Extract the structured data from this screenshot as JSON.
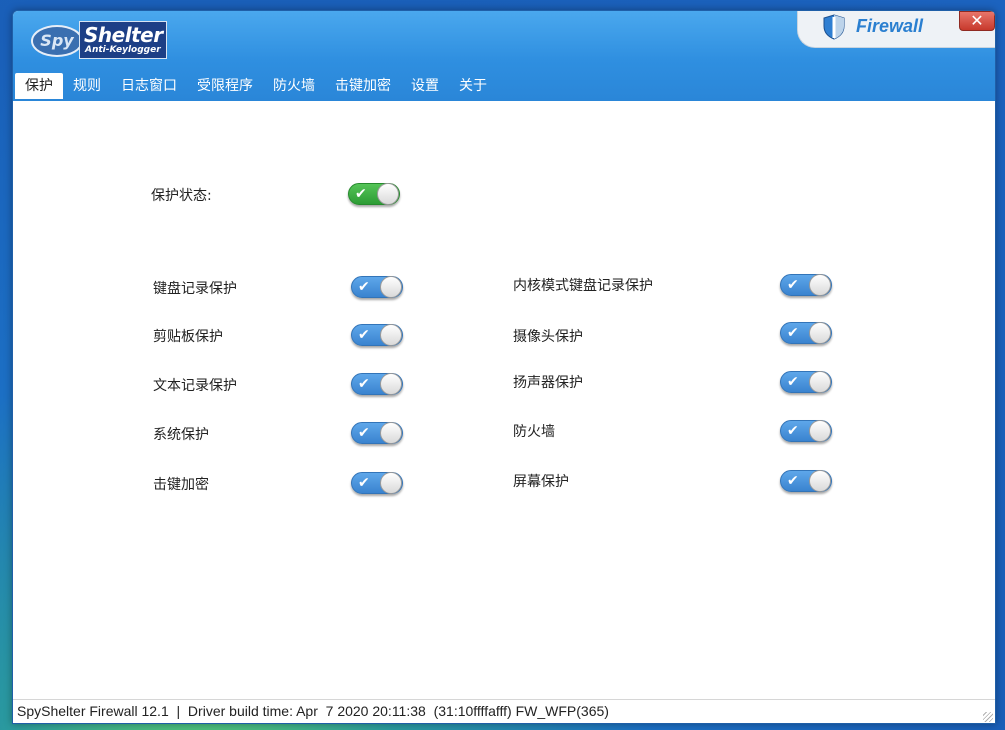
{
  "app": {
    "logo_spy": "Spy",
    "logo_shelter": "Shelter",
    "logo_tagline": "Anti-Keylogger",
    "badge_text": "Firewall",
    "close_glyph": "✕"
  },
  "menu": {
    "items": [
      {
        "label": "保护",
        "active": true
      },
      {
        "label": "规则"
      },
      {
        "label": "日志窗口"
      },
      {
        "label": "受限程序"
      },
      {
        "label": "防火墙"
      },
      {
        "label": "击键加密"
      },
      {
        "label": "设置"
      },
      {
        "label": "关于"
      }
    ]
  },
  "protection": {
    "status_label": "保护状态:",
    "status_on": true,
    "left": [
      {
        "label": "键盘记录保护",
        "on": true
      },
      {
        "label": "剪贴板保护",
        "on": true
      },
      {
        "label": "文本记录保护",
        "on": true
      },
      {
        "label": "系统保护",
        "on": true
      },
      {
        "label": "击键加密",
        "on": true
      }
    ],
    "right": [
      {
        "label": "内核模式键盘记录保护",
        "on": true
      },
      {
        "label": "摄像头保护",
        "on": true
      },
      {
        "label": "扬声器保护",
        "on": true
      },
      {
        "label": "防火墙",
        "on": true
      },
      {
        "label": "屏幕保护",
        "on": true
      }
    ]
  },
  "status_bar": {
    "text": "SpyShelter Firewall 12.1  |  Driver build time: Apr  7 2020 20:11:38  (31:10ffffafff) FW_WFP(365)"
  },
  "colors": {
    "header": "#2f8fe0",
    "toggle_blue": "#3a83cf",
    "toggle_green": "#2d9c35",
    "close_red": "#c7392c"
  }
}
